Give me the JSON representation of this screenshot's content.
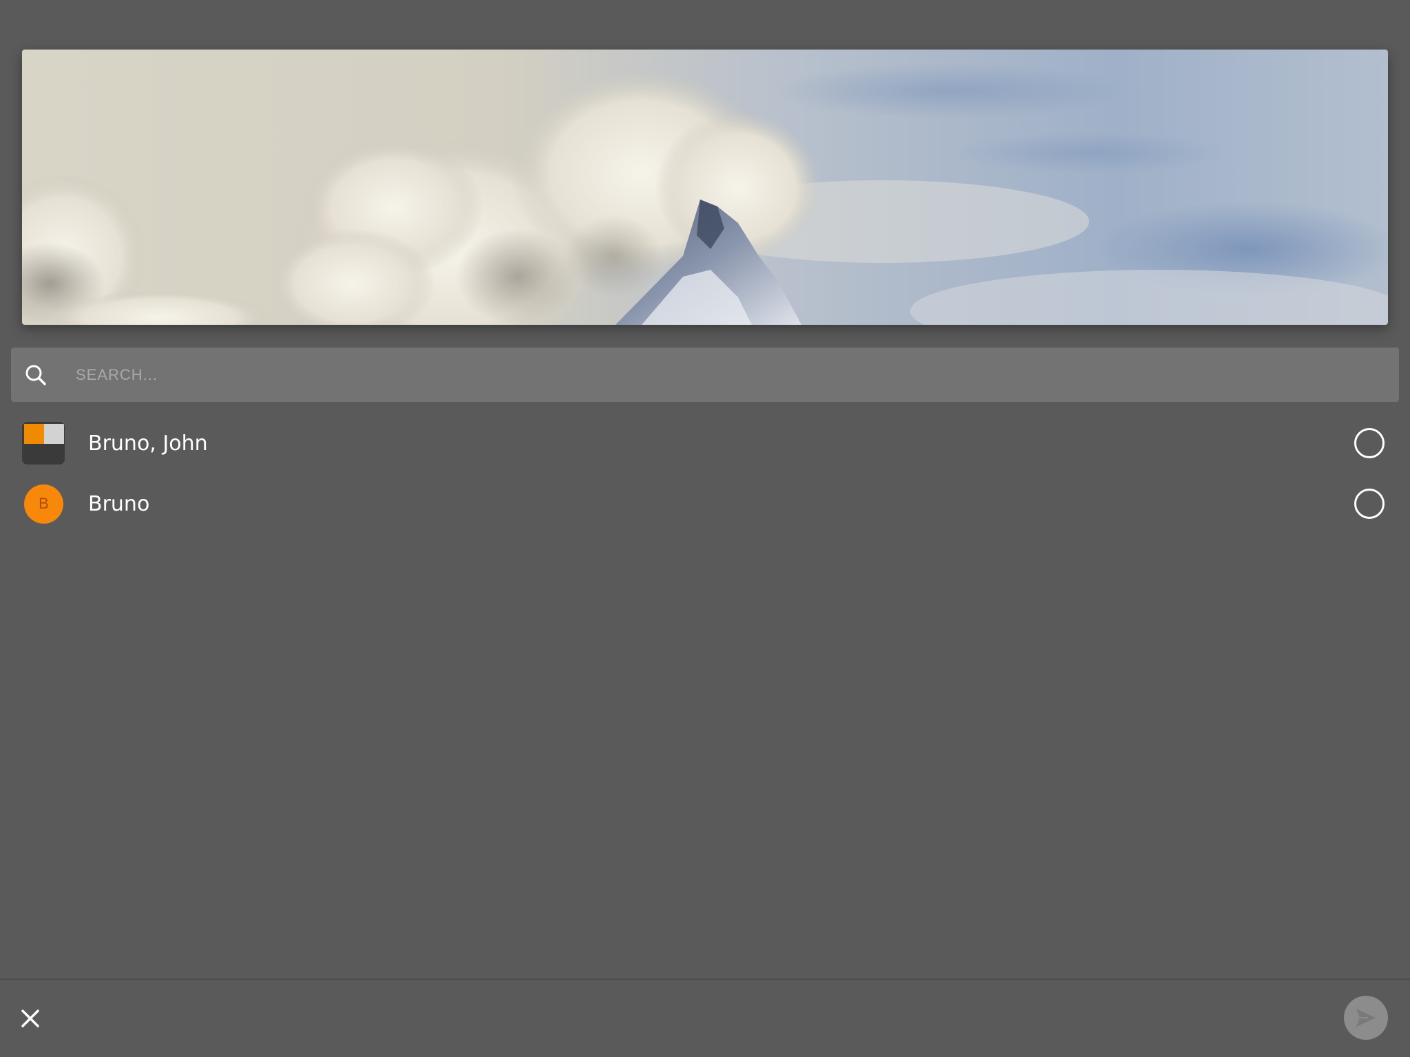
{
  "banner": {
    "image_description_icon": "mountain-clouds-photo"
  },
  "search": {
    "icon": "search-icon",
    "placeholder": "SEARCH..."
  },
  "contacts": [
    {
      "name": "Bruno, John",
      "avatar_type": "group",
      "selected": false
    },
    {
      "name": "Bruno",
      "avatar_type": "initial",
      "initial": "B",
      "selected": false
    }
  ],
  "footer": {
    "close_icon": "close-icon",
    "send_icon": "send-icon"
  },
  "colors": {
    "background": "#5a5a5a",
    "search_bg": "#737373",
    "accent_orange": "#f7880a",
    "send_button_bg": "#8c8c8c"
  }
}
